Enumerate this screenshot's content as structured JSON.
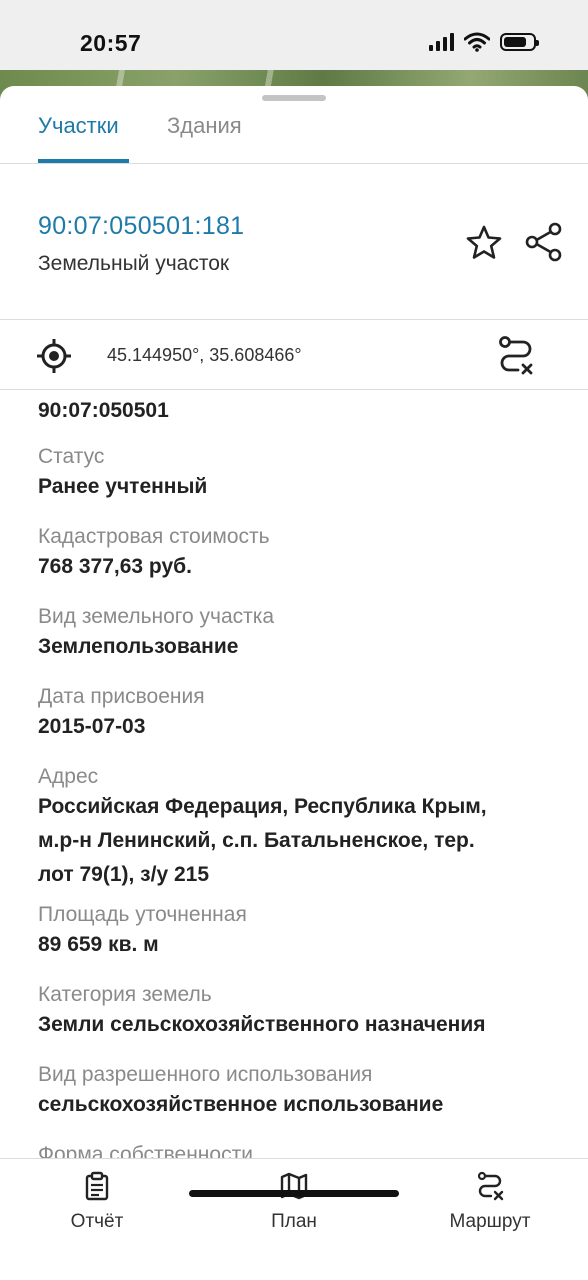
{
  "status_bar": {
    "time": "20:57"
  },
  "tabs": [
    {
      "label": "Участки",
      "active": true
    },
    {
      "label": "Здания",
      "active": false
    }
  ],
  "parcel": {
    "cadastral_number": "90:07:050501:181",
    "type": "Земельный участок"
  },
  "coordinates": "45.144950°, 35.608466°",
  "details": {
    "quarter": "90:07:050501",
    "fields": [
      {
        "label": "Статус",
        "value": "Ранее учтенный"
      },
      {
        "label": "Кадастровая стоимость",
        "value": "768 377,63 руб."
      },
      {
        "label": "Вид земельного участка",
        "value": "Землепользование"
      },
      {
        "label": "Дата присвоения",
        "value": "2015-07-03"
      },
      {
        "label": "Адрес",
        "value_lines": [
          "Российская Федерация, Республика Крым,",
          "м.р-н Ленинский, с.п. Батальненское, тер.",
          "лот 79(1), з/у 215"
        ]
      },
      {
        "label": "Площадь уточненная",
        "value": "89 659 кв. м"
      },
      {
        "label": "Категория земель",
        "value": "Земли сельскохозяйственного назначения"
      },
      {
        "label": "Вид разрешенного использования",
        "value": "сельскохозяйственное использование"
      },
      {
        "label": "Форма собственности"
      }
    ]
  },
  "bottom_nav": [
    {
      "label": "Отчёт",
      "icon": "clipboard-icon"
    },
    {
      "label": "План",
      "icon": "map-icon"
    },
    {
      "label": "Маршрут",
      "icon": "route-icon"
    }
  ],
  "colors": {
    "accent": "#1e7aa8",
    "label": "#8a8a8a",
    "text": "#222222"
  }
}
